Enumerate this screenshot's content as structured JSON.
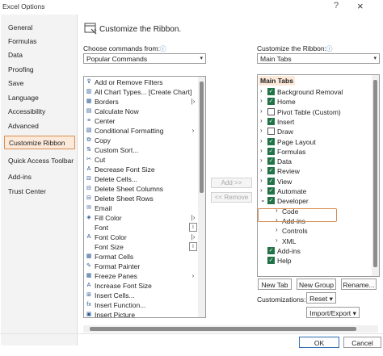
{
  "window": {
    "title": "Excel Options",
    "help_glyph": "?",
    "close_glyph": "×"
  },
  "nav": {
    "items": [
      {
        "label": "General"
      },
      {
        "label": "Formulas"
      },
      {
        "label": "Data"
      },
      {
        "label": "Proofing"
      },
      {
        "label": "Save"
      },
      {
        "label": "Language"
      },
      {
        "label": "Accessibility"
      },
      {
        "label": "Advanced"
      },
      {
        "label": "Customize Ribbon",
        "selected": true
      },
      {
        "label": "Quick Access Toolbar"
      },
      {
        "label": "Add-ins"
      },
      {
        "label": "Trust Center"
      }
    ]
  },
  "header": {
    "title": "Customize the Ribbon.",
    "icon": "ribbon-customize-icon"
  },
  "left": {
    "label": "Choose commands from:",
    "info": "ⓘ",
    "dropdown_value": "Popular Commands",
    "commands": [
      {
        "label": "Add or Remove Filters",
        "icon": "filter-icon",
        "glyph": "⊽"
      },
      {
        "label": "All Chart Types... [Create Chart]",
        "icon": "chart-icon",
        "glyph": "▥"
      },
      {
        "label": "Borders",
        "icon": "borders-icon",
        "glyph": "▦",
        "sub": "|›",
        "boxed": false
      },
      {
        "label": "Calculate Now",
        "icon": "calculator-icon",
        "glyph": "▤"
      },
      {
        "label": "Center",
        "icon": "align-center-icon",
        "glyph": "≡"
      },
      {
        "label": "Conditional Formatting",
        "icon": "conditional-format-icon",
        "glyph": "▧",
        "sub": "›"
      },
      {
        "label": "Copy",
        "icon": "copy-icon",
        "glyph": "⧉"
      },
      {
        "label": "Custom Sort...",
        "icon": "sort-icon",
        "glyph": "⇅"
      },
      {
        "label": "Cut",
        "icon": "cut-icon",
        "glyph": "✂"
      },
      {
        "label": "Decrease Font Size",
        "icon": "decrease-font-icon",
        "glyph": "A"
      },
      {
        "label": "Delete Cells...",
        "icon": "delete-cells-icon",
        "glyph": "⊟"
      },
      {
        "label": "Delete Sheet Columns",
        "icon": "delete-columns-icon",
        "glyph": "⊟"
      },
      {
        "label": "Delete Sheet Rows",
        "icon": "delete-rows-icon",
        "glyph": "⊟"
      },
      {
        "label": "Email",
        "icon": "email-icon",
        "glyph": "✉"
      },
      {
        "label": "Fill Color",
        "icon": "fill-color-icon",
        "glyph": "◈",
        "sub": "|›"
      },
      {
        "label": "Font",
        "icon": "font-icon",
        "glyph": "",
        "sub": "I",
        "boxed": true
      },
      {
        "label": "Font Color",
        "icon": "font-color-icon",
        "glyph": "A",
        "sub": "|›"
      },
      {
        "label": "Font Size",
        "icon": "font-size-icon",
        "glyph": "",
        "sub": "I",
        "boxed": true
      },
      {
        "label": "Format Cells",
        "icon": "format-cells-icon",
        "glyph": "▦"
      },
      {
        "label": "Format Painter",
        "icon": "format-painter-icon",
        "glyph": "✎"
      },
      {
        "label": "Freeze Panes",
        "icon": "freeze-panes-icon",
        "glyph": "▦",
        "sub": "›"
      },
      {
        "label": "Increase Font Size",
        "icon": "increase-font-icon",
        "glyph": "A"
      },
      {
        "label": "Insert Cells...",
        "icon": "insert-cells-icon",
        "glyph": "⊞"
      },
      {
        "label": "Insert Function...",
        "icon": "function-icon",
        "glyph": "fx"
      },
      {
        "label": "Insert Picture",
        "icon": "picture-icon",
        "glyph": "▣"
      }
    ]
  },
  "middle": {
    "add_label": "Add >>",
    "remove_label": "<< Remove"
  },
  "right": {
    "label": "Customize the Ribbon:",
    "info": "ⓘ",
    "dropdown_value": "Main Tabs",
    "tree_header": "Main Tabs",
    "tabs": [
      {
        "label": "Background Removal",
        "checked": true
      },
      {
        "label": "Home",
        "checked": true
      },
      {
        "label": "Pivot Table (Custom)",
        "checked": false
      },
      {
        "label": "Insert",
        "checked": true
      },
      {
        "label": "Draw",
        "checked": false
      },
      {
        "label": "Page Layout",
        "checked": true
      },
      {
        "label": "Formulas",
        "checked": true
      },
      {
        "label": "Data",
        "checked": true
      },
      {
        "label": "Review",
        "checked": true
      },
      {
        "label": "View",
        "checked": true
      },
      {
        "label": "Automate",
        "checked": true
      },
      {
        "label": "Developer",
        "checked": true,
        "expanded": true
      }
    ],
    "developer_groups": [
      {
        "label": "Code"
      },
      {
        "label": "Add-ins"
      },
      {
        "label": "Controls"
      },
      {
        "label": "XML"
      }
    ],
    "after_tabs": [
      {
        "label": "Add-ins",
        "checked": true
      },
      {
        "label": "Help",
        "checked": true
      }
    ],
    "new_tab_label": "New Tab",
    "new_group_label": "New Group",
    "rename_label": "Rename...",
    "customizations_label": "Customizations:",
    "reset_label": "Reset",
    "import_export_label": "Import/Export"
  },
  "footer": {
    "ok_label": "OK",
    "cancel_label": "Cancel"
  }
}
